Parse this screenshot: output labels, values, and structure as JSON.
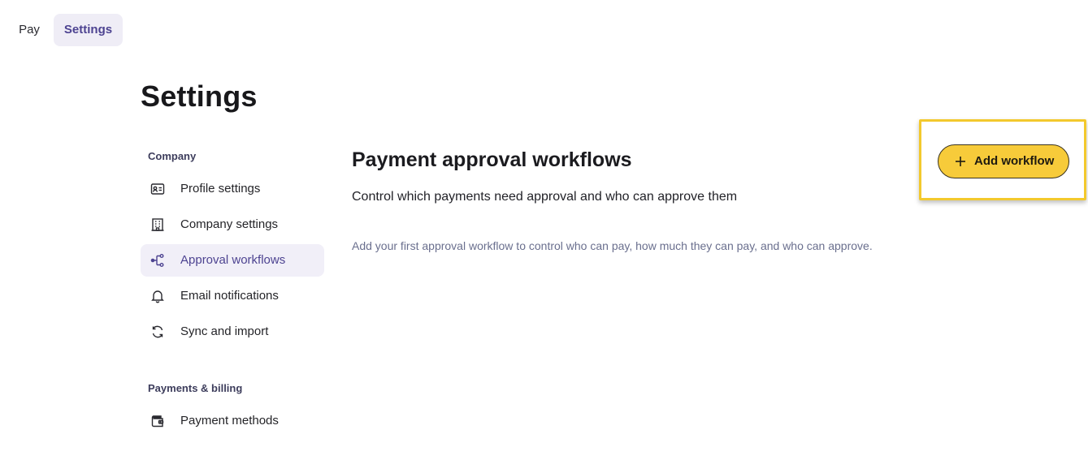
{
  "topnav": {
    "tabs": [
      {
        "label": "Pay",
        "active": false
      },
      {
        "label": "Settings",
        "active": true
      }
    ]
  },
  "page": {
    "title": "Settings"
  },
  "sidebar": {
    "groups": [
      {
        "label": "Company",
        "items": [
          {
            "label": "Profile settings",
            "icon": "id-card-icon",
            "active": false
          },
          {
            "label": "Company settings",
            "icon": "building-icon",
            "active": false
          },
          {
            "label": "Approval workflows",
            "icon": "workflow-icon",
            "active": true
          },
          {
            "label": "Email notifications",
            "icon": "bell-icon",
            "active": false
          },
          {
            "label": "Sync and import",
            "icon": "sync-icon",
            "active": false
          }
        ]
      },
      {
        "label": "Payments & billing",
        "items": [
          {
            "label": "Payment methods",
            "icon": "wallet-icon",
            "active": false
          }
        ]
      }
    ]
  },
  "main": {
    "title": "Payment approval workflows",
    "subtitle": "Control which payments need approval and who can approve them",
    "empty_state": "Add your first approval workflow to control who can pay, how much they can pay, and who can approve.",
    "add_button": {
      "label": "Add workflow",
      "icon": "plus-icon"
    }
  },
  "colors": {
    "accent": "#4d4391",
    "active_bg": "#f1eff8",
    "button_yellow": "#f7cb3a",
    "highlight": "#f3c92d",
    "muted_text": "#6a6f8e"
  }
}
